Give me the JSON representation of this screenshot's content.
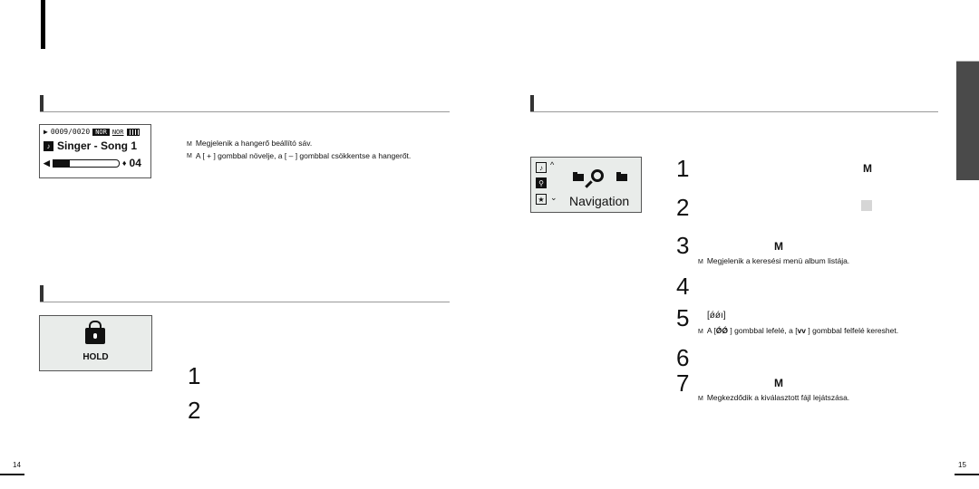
{
  "left_page": {
    "player_screen": {
      "track_counter": "0009/0020",
      "eq_mode": "NOR",
      "sound_mode": "NOR",
      "song_title": "Singer - Song 1",
      "volume_value": "04",
      "volume_level_fraction": 0.25,
      "icons": [
        "play-icon",
        "battery-icon",
        "music-note-icon",
        "speaker-icon"
      ]
    },
    "volume_notes": [
      {
        "bullet": "M",
        "text": "Megjelenik a hangerő beállító sáv."
      },
      {
        "bullet": "M",
        "text": "A [ + ] gombbal növelje, a [ – ] gombbal csökkentse a hangerőt."
      }
    ],
    "hold_screen": {
      "label": "HOLD",
      "icon": "lock-icon"
    },
    "hold_steps": [
      "1",
      "2"
    ],
    "page_number": "14"
  },
  "right_page": {
    "nav_screen": {
      "label": "Navigation",
      "icons": [
        "music-icon",
        "search-icon",
        "star-icon",
        "folder-icon",
        "magnifier-icon"
      ],
      "arrow_up": "^",
      "arrow_down": "⌄"
    },
    "steps": [
      {
        "num": "1",
        "key": "M"
      },
      {
        "num": "2"
      },
      {
        "num": "3",
        "key": "M",
        "note": "Megjelenik a keresési menü album listája."
      },
      {
        "num": "4"
      },
      {
        "num": "5",
        "key": "[ǿǿı]",
        "note_prefix": "A [",
        "note_key1": "ǾǾ",
        "note_mid": " ] gombbal lefelé, a [",
        "note_key2": "vv",
        "note_suffix": "  ] gombbal felfelé kereshet."
      },
      {
        "num": "6"
      },
      {
        "num": "7",
        "key": "M",
        "note": "Megkezdődik a kiválasztott fájl lejátszása."
      }
    ],
    "bullet": "M",
    "page_number": "15"
  }
}
